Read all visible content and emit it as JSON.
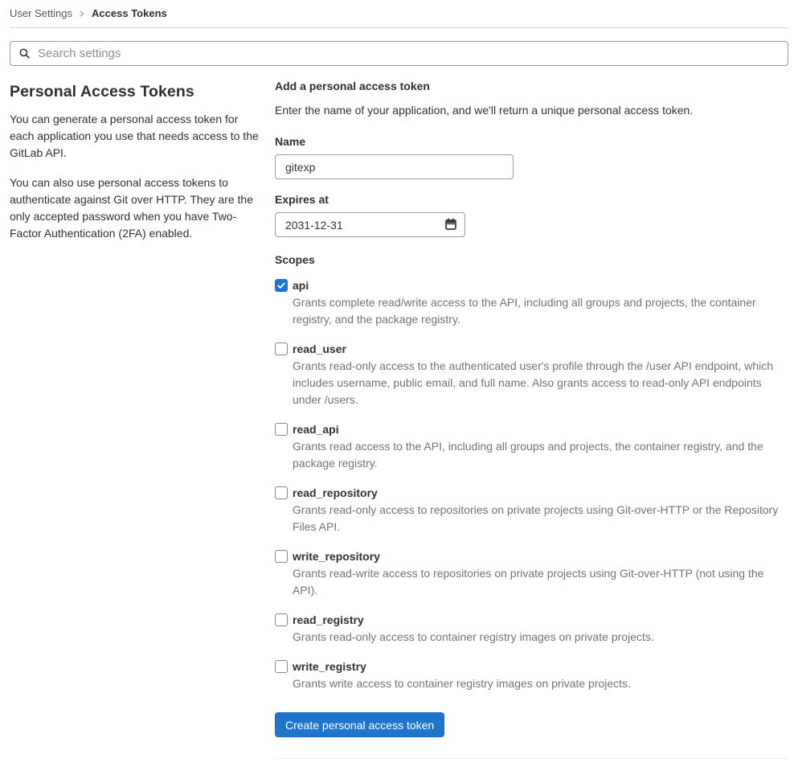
{
  "breadcrumb": {
    "items": [
      {
        "label": "User Settings"
      },
      {
        "label": "Access Tokens"
      }
    ]
  },
  "search": {
    "placeholder": "Search settings",
    "icon": "search-icon"
  },
  "sidebar": {
    "title": "Personal Access Tokens",
    "paragraphs": [
      "You can generate a personal access token for each application you use that needs access to the GitLab API.",
      "You can also use personal access tokens to authenticate against Git over HTTP. They are the only accepted password when you have Two-Factor Authentication (2FA) enabled."
    ]
  },
  "form": {
    "title": "Add a personal access token",
    "description": "Enter the name of your application, and we'll return a unique personal access token.",
    "name_label": "Name",
    "name_value": "gitexp",
    "expires_label": "Expires at",
    "expires_value": "2031-12-31",
    "expires_icon": "calendar-icon",
    "scopes_label": "Scopes",
    "scopes": [
      {
        "name": "api",
        "checked": true,
        "description": "Grants complete read/write access to the API, including all groups and projects, the container registry, and the package registry."
      },
      {
        "name": "read_user",
        "checked": false,
        "description": "Grants read-only access to the authenticated user's profile through the /user API endpoint, which includes username, public email, and full name. Also grants access to read-only API endpoints under /users."
      },
      {
        "name": "read_api",
        "checked": false,
        "description": "Grants read access to the API, including all groups and projects, the container registry, and the package registry."
      },
      {
        "name": "read_repository",
        "checked": false,
        "description": "Grants read-only access to repositories on private projects using Git-over-HTTP or the Repository Files API."
      },
      {
        "name": "write_repository",
        "checked": false,
        "description": "Grants read-write access to repositories on private projects using Git-over-HTTP (not using the API)."
      },
      {
        "name": "read_registry",
        "checked": false,
        "description": "Grants read-only access to container registry images on private projects."
      },
      {
        "name": "write_registry",
        "checked": false,
        "description": "Grants write access to container registry images on private projects."
      }
    ],
    "submit_label": "Create personal access token"
  },
  "colors": {
    "accent_blue": "#1f75cb",
    "checkbox_checked": "#1f75cb",
    "description_gray": "#737278"
  }
}
